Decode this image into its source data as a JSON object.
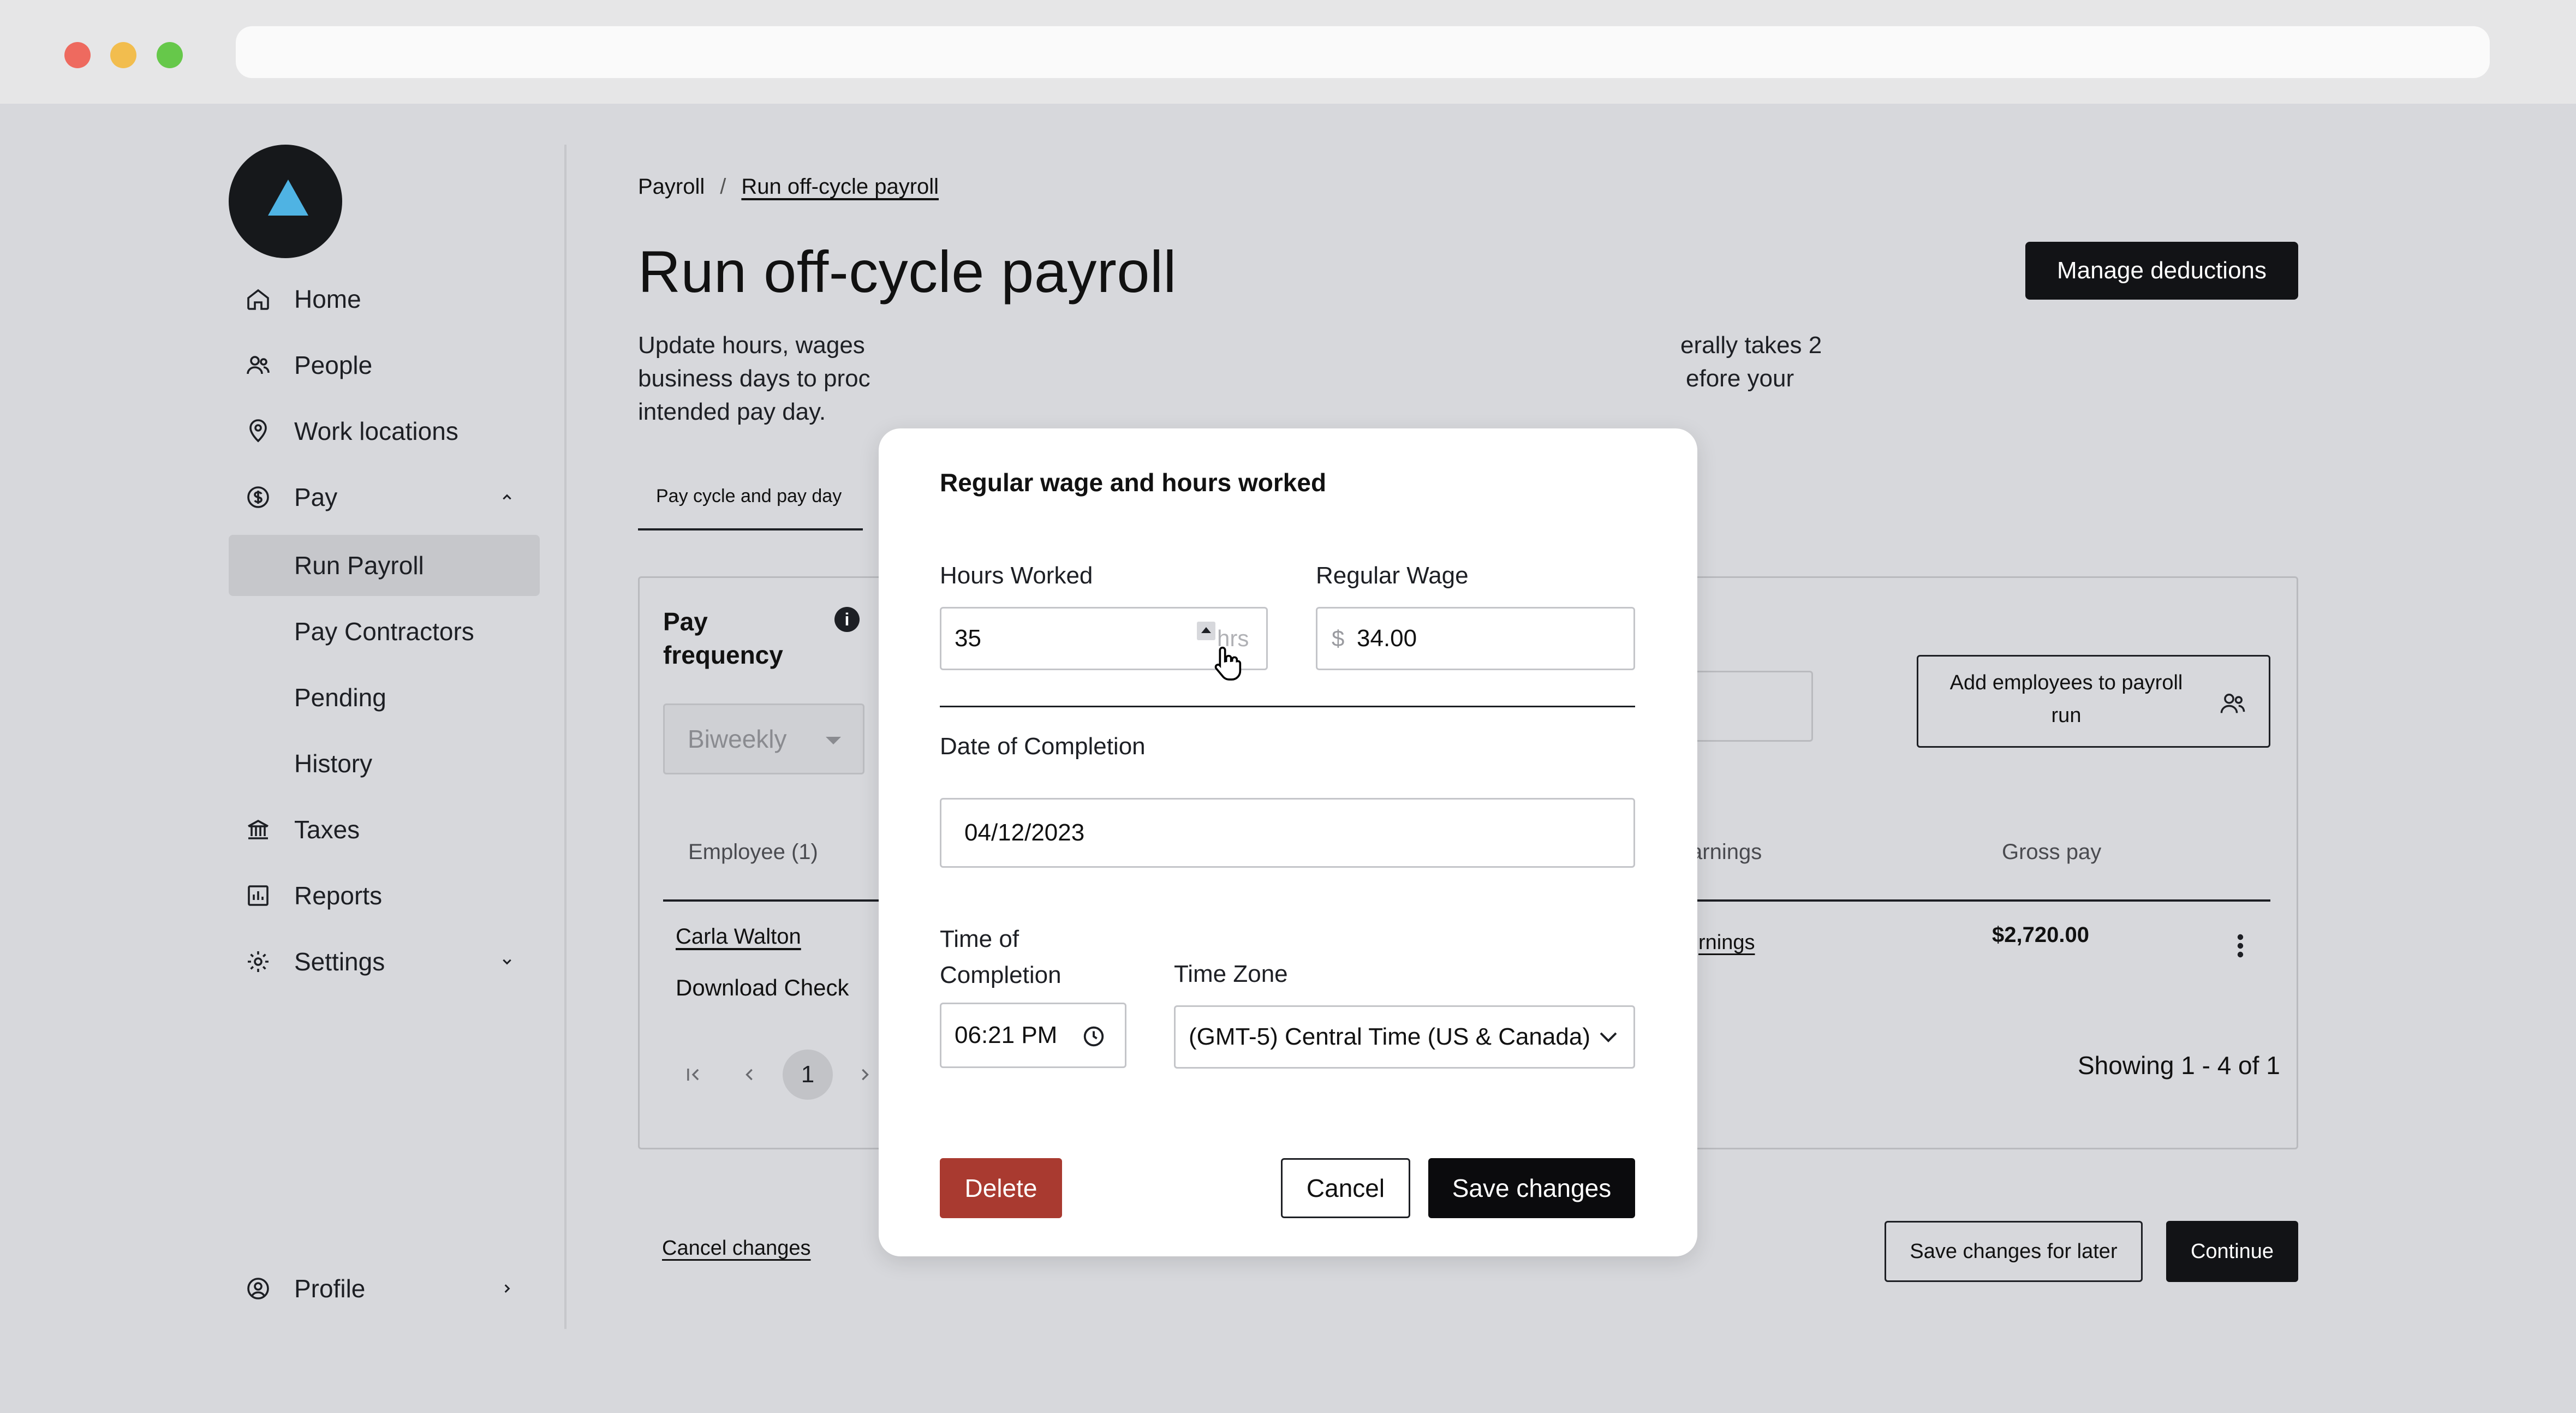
{
  "sidebar": {
    "items": [
      {
        "label": "Home",
        "icon": "home-icon"
      },
      {
        "label": "People",
        "icon": "people-icon"
      },
      {
        "label": "Work locations",
        "icon": "location-pin-icon"
      },
      {
        "label": "Pay",
        "icon": "dollar-circle-icon"
      },
      {
        "label": "Run Payroll"
      },
      {
        "label": "Pay Contractors"
      },
      {
        "label": "Pending"
      },
      {
        "label": "History"
      },
      {
        "label": "Taxes",
        "icon": "bank-icon"
      },
      {
        "label": "Reports",
        "icon": "chart-icon"
      },
      {
        "label": "Settings",
        "icon": "gear-icon"
      }
    ],
    "profile_label": "Profile"
  },
  "breadcrumb": {
    "root": "Payroll",
    "sep": "/",
    "current": "Run off-cycle payroll"
  },
  "page": {
    "title": "Run off-cycle payroll",
    "manage_label": "Manage deductions",
    "desc_left_1": "Update hours, wages",
    "desc_left_2": "business days to proc",
    "desc_left_3": "intended pay day.",
    "desc_right_1": "erally takes 2",
    "desc_right_2": "efore your",
    "tab_label": "Pay cycle and pay day"
  },
  "card": {
    "pay_frequency_label": "Pay frequency",
    "frequency_value": "Biweekly",
    "add_employees_label": "Add employees to payroll run",
    "columns": {
      "employee": "Employee (1)",
      "earnings": "arnings",
      "gross": "Gross pay"
    },
    "row": {
      "name": "Carla Walton",
      "earnings_link": "rnings",
      "gross": "$2,720.00",
      "download": "Download Check"
    },
    "page_number": "1",
    "showing": "Showing 1 - 4 of 1"
  },
  "footer": {
    "cancel_changes": "Cancel changes",
    "save_later": "Save changes for later",
    "continue": "Continue"
  },
  "modal": {
    "title": "Regular wage and hours worked",
    "hours_label": "Hours Worked",
    "hours_value": "35",
    "hours_suffix": "hrs",
    "wage_label": "Regular Wage",
    "wage_prefix": "$",
    "wage_value": "34.00",
    "date_label": "Date of Completion",
    "date_value": "04/12/2023",
    "time_label_1": "Time of",
    "time_label_2": "Completion",
    "time_value": "06:21 PM",
    "tz_label": "Time Zone",
    "tz_value": "(GMT-5) Central Time (US & Canada)",
    "delete_label": "Delete",
    "cancel_label": "Cancel",
    "save_label": "Save changes"
  },
  "colors": {
    "accent_dark": "#121316",
    "delete_red": "#a93a30",
    "logo_blue": "#4fb3e3"
  }
}
